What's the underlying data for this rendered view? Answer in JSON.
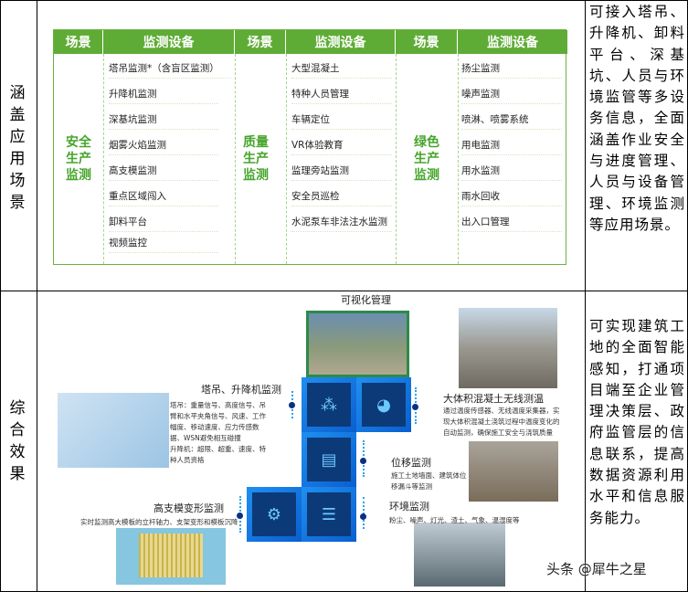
{
  "row1": {
    "label": "涵盖应用场景",
    "description": "可接入塔吊、升降机、卸料平台、深基坑、人员与环境监管等多设务信息，全面涵盖作业安全与进度管理、人员与设备管理、环境监测等应用场景。",
    "table": {
      "headers": [
        "场景",
        "监测设备",
        "场景",
        "监测设备",
        "场景",
        "监测设备"
      ],
      "groups": [
        {
          "scene": "安全生产监测",
          "items": [
            "塔吊监测*（含盲区监测）",
            "升降机监测",
            "深基坑监测",
            "烟雾火焰监测",
            "高支模监测",
            "重点区域闯入",
            "卸料平台",
            "视频监控"
          ]
        },
        {
          "scene": "质量生产监测",
          "items": [
            "大型混凝土",
            "特种人员管理",
            "车辆定位",
            "VR体验教育",
            "监理旁站监测",
            "安全员巡检",
            "水泥泵车非法注水监测"
          ]
        },
        {
          "scene": "绿色生产监测",
          "items": [
            "扬尘监测",
            "噪声监测",
            "喷淋、喷雾系统",
            "用电监测",
            "用水监测",
            "雨水回收",
            "出入口管理"
          ]
        }
      ]
    }
  },
  "row2": {
    "label": "综合效果",
    "description": "可实现建筑工地的全面智能感知，打通项目端至企业管理决策层、政府监管层的信息联系，提高数据资源利用水平和信息服务能力。",
    "figure": {
      "title": "可视化管理",
      "crane": {
        "title": "塔吊、升降机监测",
        "text": "塔吊：重量信号、高度信号、吊臂和水平夹角信号、风速、工作幅度、移动速度、应力传感数据、WSN避免相互碰撞",
        "text2": "升降机：超限、超重、速度、特种人员资格"
      },
      "concrete": {
        "title": "大体积混凝土无线测温",
        "text": "通过温度传感器、无线温度采集器，实现大体积混凝土浇筑过程中温度变化的自动监测，确保施工安全与浇筑质量"
      },
      "displacement": {
        "title": "位移监测",
        "text": "施工土地墙面、建筑体位移漏斗等监测"
      },
      "environment": {
        "title": "环境监测",
        "text": "粉尘、噪声、灯光、渣土、气象、温湿度等"
      },
      "formwork": {
        "title": "高支模变形监测",
        "text": "实时监测高大模板的立杆轴力、支架变形和模板沉降"
      }
    },
    "watermark": "头条 @犀牛之星"
  }
}
